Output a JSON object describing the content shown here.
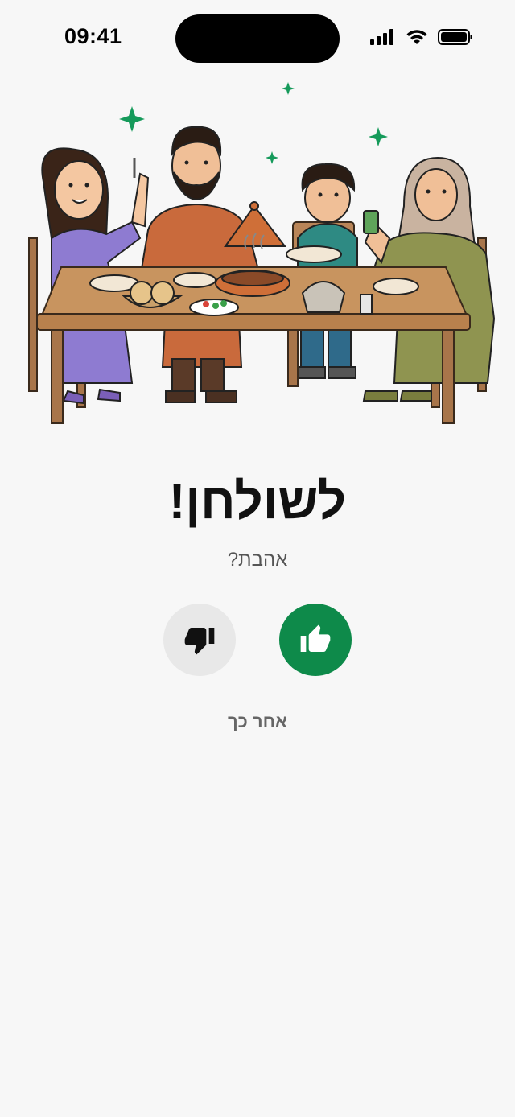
{
  "status_bar": {
    "time": "09:41"
  },
  "illustration": {
    "icon": "family-dinner-illustration"
  },
  "content": {
    "headline": "לשולחן!",
    "question": "אהבת?",
    "later_label": "אחר כך"
  },
  "actions": {
    "dislike_icon": "thumbs-down-icon",
    "like_icon": "thumbs-up-icon"
  },
  "colors": {
    "accent": "#0e8a4a",
    "dislike_bg": "#e8e8e8",
    "background": "#f7f7f7"
  }
}
